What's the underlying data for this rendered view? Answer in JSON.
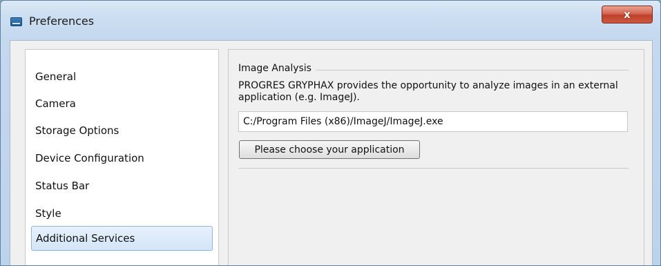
{
  "window": {
    "title": "Preferences",
    "close_label": "x",
    "app_icon": "app-window-icon"
  },
  "sidebar": {
    "items": [
      {
        "label": "General"
      },
      {
        "label": "Camera"
      },
      {
        "label": "Storage Options"
      },
      {
        "label": "Device Configuration"
      },
      {
        "label": "Status Bar"
      },
      {
        "label": "Style"
      },
      {
        "label": "Additional Services",
        "selected": true
      }
    ]
  },
  "content": {
    "group_title": "Image Analysis",
    "description": "PROGRES GRYPHAX provides the opportunity to analyze images in an external application (e.g. ImageJ).",
    "path_value": "C:/Program Files (x86)/ImageJ/ImageJ.exe",
    "choose_button": "Please choose your application"
  },
  "colors": {
    "selection_border": "#8fb6dd",
    "close_button": "#c0402a"
  }
}
